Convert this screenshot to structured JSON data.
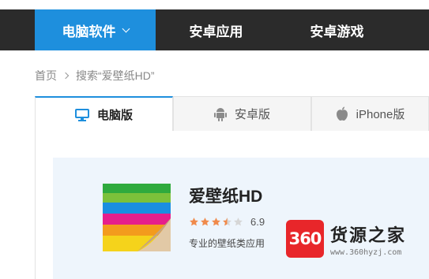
{
  "nav": {
    "items": [
      {
        "label": "电脑软件",
        "active": true
      },
      {
        "label": "安卓应用",
        "active": false
      },
      {
        "label": "安卓游戏",
        "active": false
      }
    ]
  },
  "breadcrumb": {
    "home": "首页",
    "current": "搜索“爱壁纸HD”"
  },
  "tabs": [
    {
      "label": "电脑版",
      "icon": "monitor-icon",
      "active": true
    },
    {
      "label": "安卓版",
      "icon": "android-icon",
      "active": false
    },
    {
      "label": "iPhone版",
      "icon": "apple-icon",
      "active": false
    }
  ],
  "app": {
    "name": "爱壁纸HD",
    "rating": "6.9",
    "stars_filled_fraction": 0.69,
    "description": "专业的壁纸类应用"
  },
  "watermark": {
    "badge": "360",
    "title": "货源之家",
    "url": "www.360hyzj.com"
  },
  "colors": {
    "accent": "#1e8fdd",
    "nav_bg": "#2b2b2b",
    "star": "#f08a4b",
    "card_bg": "#eef5fc",
    "watermark_red": "#e8262a"
  }
}
